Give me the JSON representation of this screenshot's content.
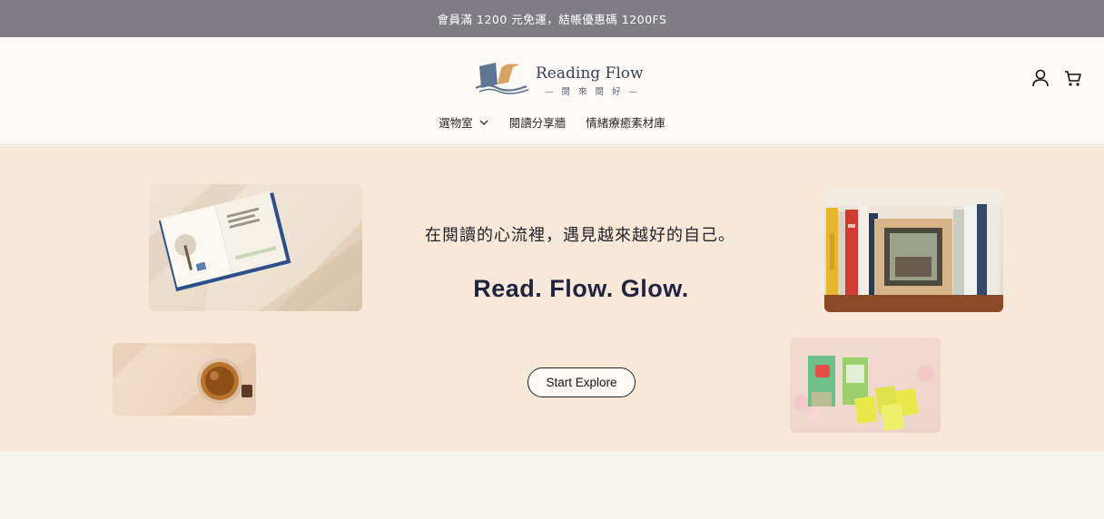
{
  "announcement": {
    "text": "會員滿 1200 元免運，結帳優惠碼 1200FS"
  },
  "brand": {
    "name": "Reading Flow",
    "tagline": "— 閱 來 閱 好 —"
  },
  "nav": {
    "items": [
      {
        "label": "選物室",
        "has_dropdown": true
      },
      {
        "label": "閱讀分享牆"
      },
      {
        "label": "情緒療癒素材庫"
      }
    ]
  },
  "header_icons": {
    "account": "user-icon",
    "cart": "cart-icon"
  },
  "hero": {
    "subtitle": "在閱讀的心流裡，遇見越來越好的自己。",
    "title": "Read. Flow. Glow.",
    "cta_label": "Start Explore",
    "background": "#f8e8da"
  },
  "colors": {
    "announcement_bg": "#7f7d83",
    "header_bg": "#fdf9f6",
    "title": "#1f2440"
  }
}
